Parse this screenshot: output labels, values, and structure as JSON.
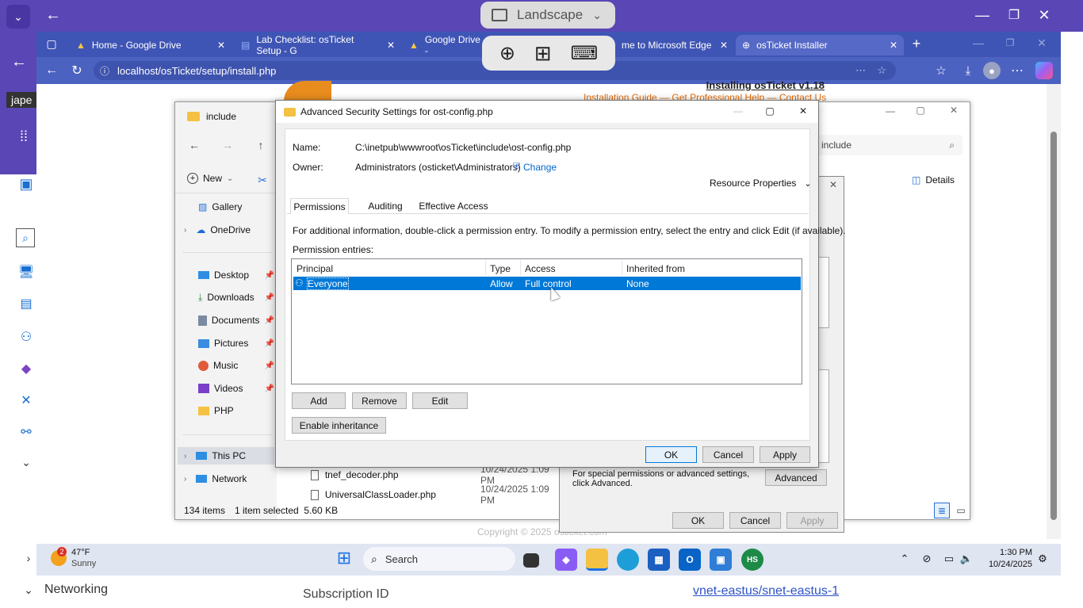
{
  "host": {
    "orientation_label": "Landscape",
    "left_cut_label": "jape",
    "bottom_left": "Networking",
    "bottom_mid": "Subscription ID",
    "bottom_link": "vnet-eastus/snet-eastus-1"
  },
  "browser": {
    "tabs": [
      {
        "label": "Home - Google Drive"
      },
      {
        "label": "Lab Checklist: osTicket Setup - G"
      },
      {
        "label": "Google Drive - "
      },
      {
        "label": "me to Microsoft Edge"
      },
      {
        "label": "osTicket Installer"
      }
    ],
    "url": "localhost/osTicket/setup/install.php"
  },
  "installer": {
    "heading": "Installing osTicket v1.18",
    "link1": "Installation Guide",
    "link2": "Get Professional Help",
    "link3": "Contact Us",
    "sep": "—",
    "copyright": "Copyright © 2025 osticket.com"
  },
  "explorer": {
    "title": "include",
    "search_placeholder": "include",
    "new_label": "New",
    "details_label": "Details",
    "nav": [
      {
        "label": "Gallery"
      },
      {
        "label": "OneDrive"
      },
      {
        "label": "Desktop"
      },
      {
        "label": "Downloads"
      },
      {
        "label": "Documents"
      },
      {
        "label": "Pictures"
      },
      {
        "label": "Music"
      },
      {
        "label": "Videos"
      },
      {
        "label": "PHP"
      },
      {
        "label": "This PC"
      },
      {
        "label": "Network"
      }
    ],
    "files": [
      {
        "name": "tnef_decoder.php",
        "date": "10/24/2025 1:09 PM"
      },
      {
        "name": "UniversalClassLoader.php",
        "date": "10/24/2025 1:09 PM"
      }
    ],
    "status": {
      "items": "134 items",
      "selected": "1 item selected  5.60 KB"
    }
  },
  "props": {
    "advanced_text": "For special permissions or advanced settings, click Advanced.",
    "advanced_btn": "Advanced",
    "ok": "OK",
    "cancel": "Cancel",
    "apply": "Apply"
  },
  "adv": {
    "title": "Advanced Security Settings for ost-config.php",
    "name_label": "Name:",
    "name_value": "C:\\inetpub\\wwwroot\\osTicket\\include\\ost-config.php",
    "owner_label": "Owner:",
    "owner_value": "Administrators (osticket\\Administrators)",
    "change": "Change",
    "resource_props": "Resource Properties",
    "tabs": [
      "Permissions",
      "Auditing",
      "Effective Access"
    ],
    "info": "For additional information, double-click a permission entry. To modify a permission entry, select the entry and click Edit (if available).",
    "entries_label": "Permission entries:",
    "columns": [
      "Principal",
      "Type",
      "Access",
      "Inherited from"
    ],
    "row": {
      "principal": "Everyone",
      "type": "Allow",
      "access": "Full control",
      "inherited": "None"
    },
    "add": "Add",
    "remove": "Remove",
    "edit": "Edit",
    "enable_inheritance": "Enable inheritance",
    "ok": "OK",
    "cancel": "Cancel",
    "apply": "Apply"
  },
  "taskbar": {
    "weather_temp": "47°F",
    "weather_desc": "Sunny",
    "weather_badge": "2",
    "search_label": "Search",
    "time": "1:30 PM",
    "date": "10/24/2025"
  },
  "colors": {
    "host": "#5a47b5",
    "browser_tabbar": "#3f55b5",
    "selection": "#0078d7",
    "orange": "#e36c09"
  }
}
